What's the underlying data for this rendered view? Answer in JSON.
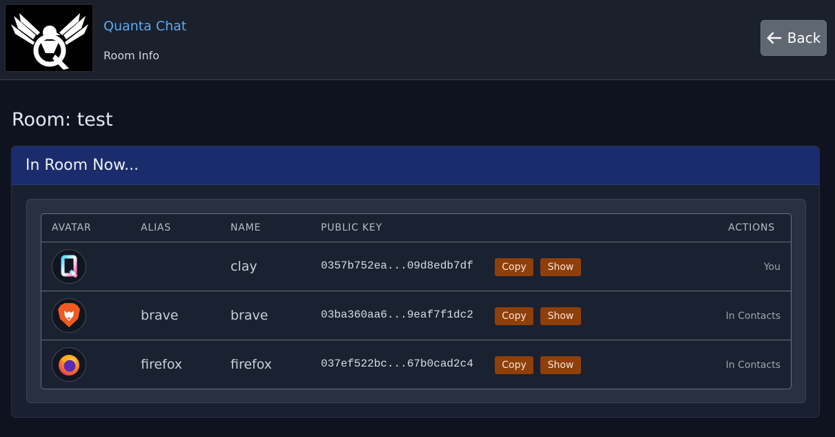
{
  "header": {
    "app_title": "Quanta Chat",
    "subtitle": "Room Info",
    "back_label": "Back",
    "logo_icon": "eagle-logo-icon"
  },
  "room": {
    "title": "Room: test"
  },
  "panel": {
    "title": "In Room Now..."
  },
  "table": {
    "columns": [
      "AVATAR",
      "ALIAS",
      "NAME",
      "PUBLIC KEY",
      "ACTIONS"
    ],
    "rows": [
      {
        "avatar_icon": "q-avatar-icon",
        "alias": "",
        "name": "clay",
        "public_key": "0357b752ea...09d8edb7df",
        "copy_label": "Copy",
        "show_label": "Show",
        "action": "You"
      },
      {
        "avatar_icon": "brave-lion-icon",
        "alias": "brave",
        "name": "brave",
        "public_key": "03ba360aa6...9eaf7f1dc2",
        "copy_label": "Copy",
        "show_label": "Show",
        "action": "In Contacts"
      },
      {
        "avatar_icon": "firefox-icon",
        "alias": "firefox",
        "name": "firefox",
        "public_key": "037ef522bc...67b0cad2c4",
        "copy_label": "Copy",
        "show_label": "Show",
        "action": "In Contacts"
      }
    ]
  },
  "colors": {
    "accent_link": "#5eaaf0",
    "panel_header": "#1b2c6c",
    "action_button": "#8e3f0a",
    "back_button": "#5f6770"
  }
}
